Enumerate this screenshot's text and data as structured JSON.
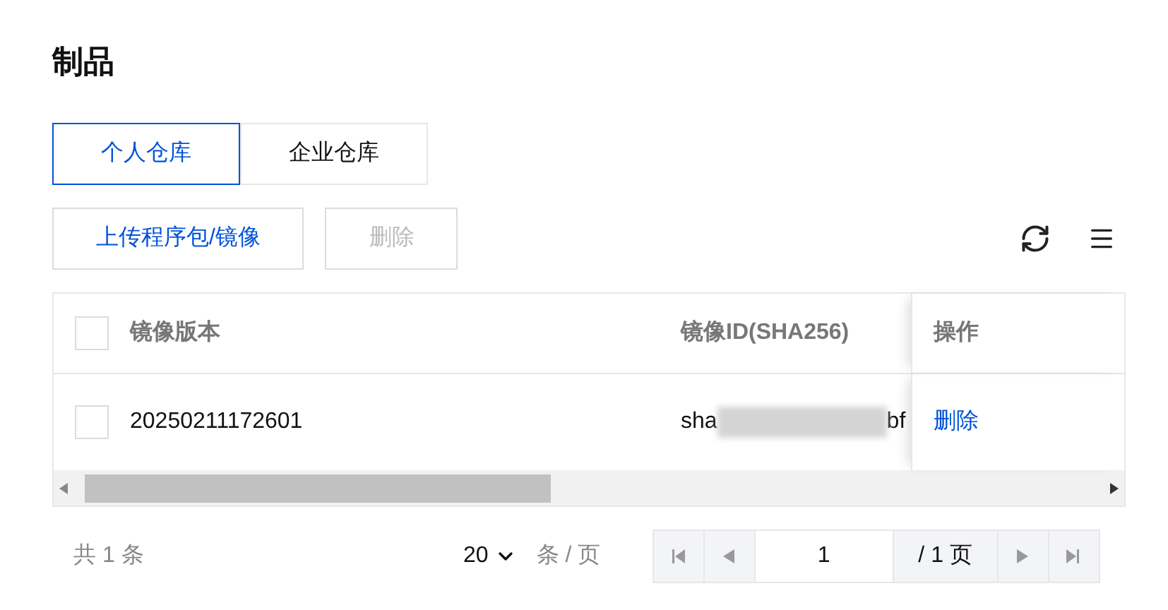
{
  "title": "制品",
  "tabs": [
    {
      "label": "个人仓库",
      "selected": true
    },
    {
      "label": "企业仓库",
      "selected": false
    }
  ],
  "toolbar": {
    "buttons": [
      {
        "label": "上传程序包/镜像",
        "disabled": false
      },
      {
        "label": "删除",
        "disabled": true
      }
    ]
  },
  "table": {
    "columns": [
      "镜像版本",
      "镜像ID(SHA256)",
      "操作"
    ],
    "select_all_checked": false,
    "rows": [
      {
        "checked": false,
        "version": "20250211172601",
        "id_start": "sha",
        "id_end": "bf",
        "action": "删除"
      }
    ]
  },
  "pagination": {
    "total": "共 1 条",
    "page_size": "20",
    "page_size_unit": "条 / 页",
    "page": "1",
    "page_total": "/ 1 页"
  }
}
